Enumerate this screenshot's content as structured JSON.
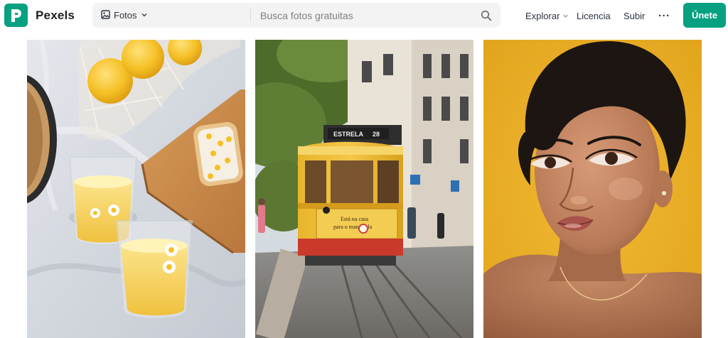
{
  "brand": {
    "name": "Pexels"
  },
  "search": {
    "type_label": "Fotos",
    "placeholder": "Busca fotos gratuitas"
  },
  "nav": {
    "explore": "Explorar",
    "license": "Licencia",
    "upload": "Subir",
    "more": "···",
    "join": "Únete"
  },
  "icons": {
    "logo": "pexels-logo-icon",
    "type": "image-icon",
    "type_chevron": "chevron-down-icon",
    "explore_chevron": "chevron-down-icon",
    "search": "search-icon"
  },
  "colors": {
    "accent": "#07a081",
    "search_bg": "#f3f3f3"
  },
  "photos": {
    "tram_sign": "ESTRELA",
    "tram_number": "28",
    "tram_ad": "Está na casa\npara o mandriola",
    "tram_ad_line1": "Está na casa",
    "tram_ad_line2": "para o mandriola"
  }
}
